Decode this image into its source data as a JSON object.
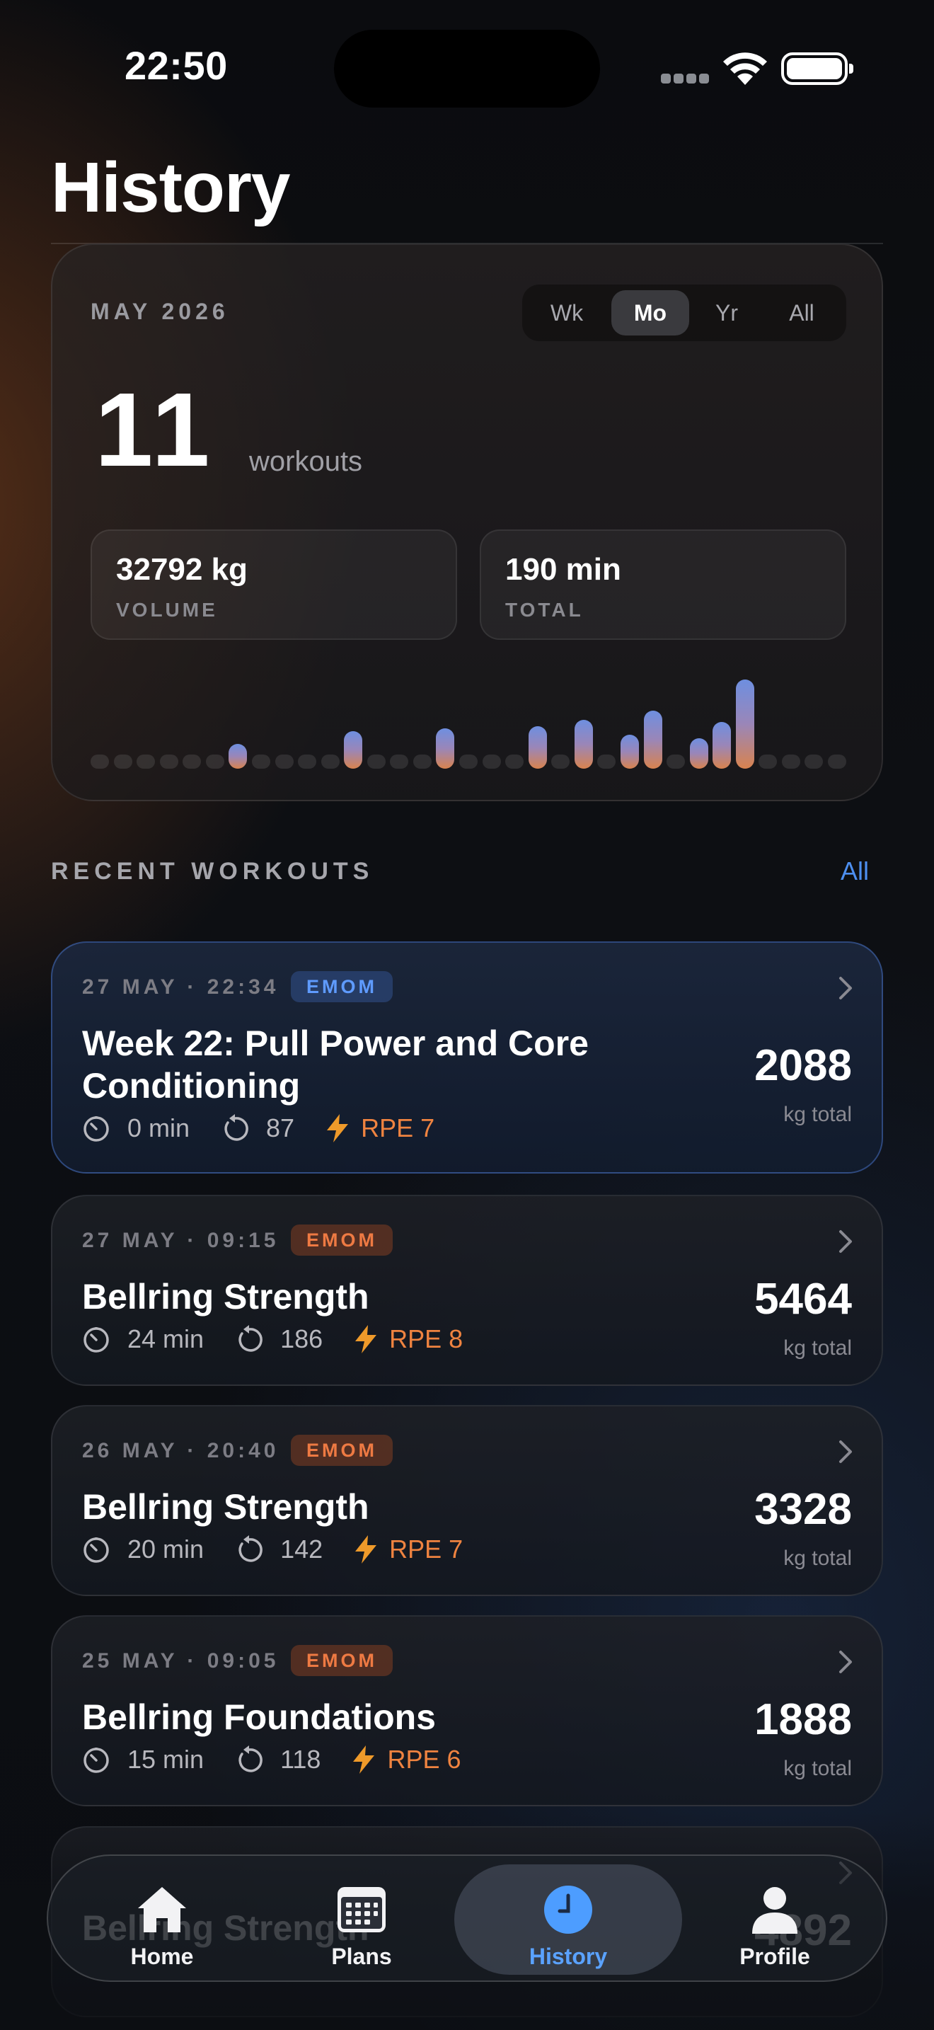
{
  "status_bar": {
    "time": "22:50"
  },
  "page": {
    "title": "History"
  },
  "summary": {
    "period_label": "MAY 2026",
    "segments": [
      "Wk",
      "Mo",
      "Yr",
      "All"
    ],
    "active_segment": "Mo",
    "count": "11",
    "count_unit": "workouts",
    "stats": [
      {
        "value": "32792 kg",
        "label": "VOLUME"
      },
      {
        "value": "190 min",
        "label": "TOTAL"
      }
    ],
    "daily_volume_relative": [
      0,
      0,
      0,
      0,
      0,
      0,
      0.28,
      0,
      0,
      0,
      0,
      0.42,
      0,
      0,
      0,
      0.45,
      0,
      0,
      0,
      0.48,
      0,
      0.55,
      0,
      0.38,
      0.65,
      0,
      0.34,
      0.52,
      1.0,
      0,
      0,
      0,
      0
    ]
  },
  "recent": {
    "header": "RECENT WORKOUTS",
    "all_label": "All",
    "items": [
      {
        "date": "27 MAY · 22:34",
        "badge": "EMOM",
        "badge_color": "blue",
        "title": "Week 22: Pull Power and Core Conditioning",
        "duration": "0 min",
        "reps": "87",
        "rpe": "RPE 7",
        "total": "2088",
        "total_label": "kg total"
      },
      {
        "date": "27 MAY · 09:15",
        "badge": "EMOM",
        "badge_color": "orange",
        "title": "Bellring Strength",
        "duration": "24 min",
        "reps": "186",
        "rpe": "RPE 8",
        "total": "5464",
        "total_label": "kg total"
      },
      {
        "date": "26 MAY · 20:40",
        "badge": "EMOM",
        "badge_color": "orange",
        "title": "Bellring Strength",
        "duration": "20 min",
        "reps": "142",
        "rpe": "RPE 7",
        "total": "3328",
        "total_label": "kg total"
      },
      {
        "date": "25 MAY · 09:05",
        "badge": "EMOM",
        "badge_color": "orange",
        "title": "Bellring Foundations",
        "duration": "15 min",
        "reps": "118",
        "rpe": "RPE 6",
        "total": "1888",
        "total_label": "kg total"
      },
      {
        "date": "",
        "badge": "",
        "badge_color": "orange",
        "title": "Bellring Strength",
        "duration": "",
        "reps": "",
        "rpe": "",
        "total": "4892",
        "total_label": ""
      }
    ]
  },
  "tab_bar": {
    "tabs": [
      {
        "label": "Home",
        "icon": "home-icon"
      },
      {
        "label": "Plans",
        "icon": "calendar-icon"
      },
      {
        "label": "History",
        "icon": "clock-icon"
      },
      {
        "label": "Profile",
        "icon": "person-icon"
      }
    ],
    "active": "History"
  },
  "colors": {
    "accent_blue": "#4d8ff0",
    "accent_orange": "#ef8340",
    "bar_gradient": [
      "#6e8fe0",
      "#d8834f"
    ]
  }
}
